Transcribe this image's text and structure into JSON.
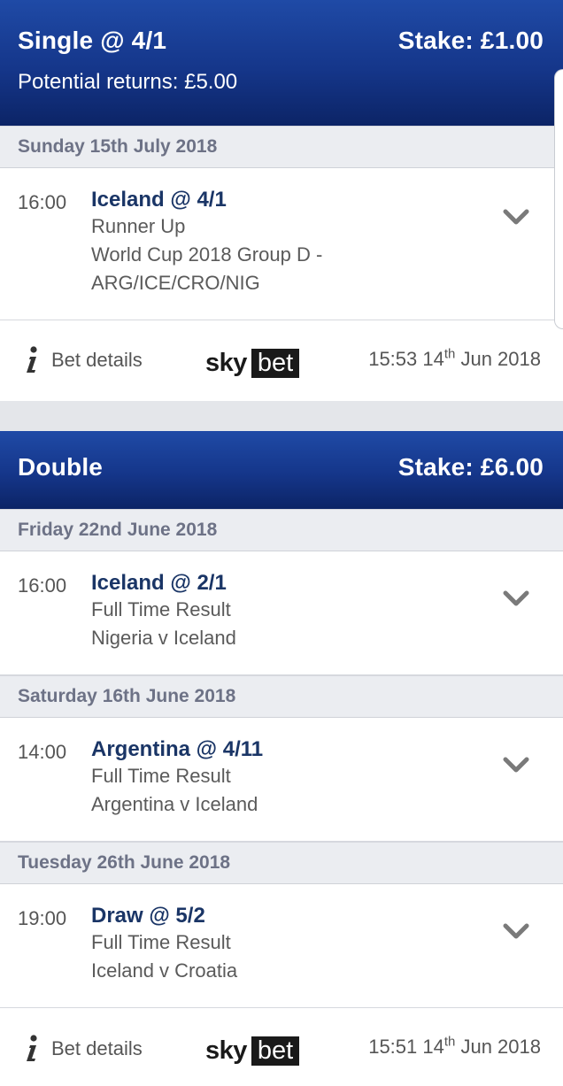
{
  "bets": [
    {
      "type": "Single @ 4/1",
      "stake": "Stake: £1.00",
      "returns": "Potential returns: £5.00",
      "groups": [
        {
          "date": "Sunday 15th July 2018",
          "selections": [
            {
              "time": "16:00",
              "title": "Iceland @ 4/1",
              "lines": [
                "Runner Up",
                "World Cup 2018 Group D -",
                "ARG/ICE/CRO/NIG"
              ]
            }
          ]
        }
      ],
      "footer": {
        "details_label": "Bet details",
        "logo_sky": "sky",
        "logo_bet": "bet",
        "time": "15:53 14",
        "ordinal": "th",
        "date_rest": " Jun 2018"
      }
    },
    {
      "type": "Double",
      "stake": "Stake: £6.00",
      "groups": [
        {
          "date": "Friday 22nd June 2018",
          "selections": [
            {
              "time": "16:00",
              "title": "Iceland @ 2/1",
              "lines": [
                "Full Time Result",
                "Nigeria v Iceland"
              ]
            }
          ]
        },
        {
          "date": "Saturday 16th June 2018",
          "selections": [
            {
              "time": "14:00",
              "title": "Argentina @ 4/11",
              "lines": [
                "Full Time Result",
                "Argentina v Iceland"
              ]
            }
          ]
        },
        {
          "date": "Tuesday 26th June 2018",
          "selections": [
            {
              "time": "19:00",
              "title": "Draw @ 5/2",
              "lines": [
                "Full Time Result",
                "Iceland v Croatia"
              ]
            }
          ]
        }
      ],
      "footer": {
        "details_label": "Bet details",
        "logo_sky": "sky",
        "logo_bet": "bet",
        "time": "15:51 14",
        "ordinal": "th",
        "date_rest": " Jun 2018"
      }
    }
  ],
  "colors": {
    "header_top": "#1f4aa6",
    "header_bottom": "#0c2466",
    "selection_title": "#1a3566",
    "date_text": "#6d7286"
  },
  "icons": {
    "info": "info-icon",
    "expand": "chevron-down-icon"
  }
}
